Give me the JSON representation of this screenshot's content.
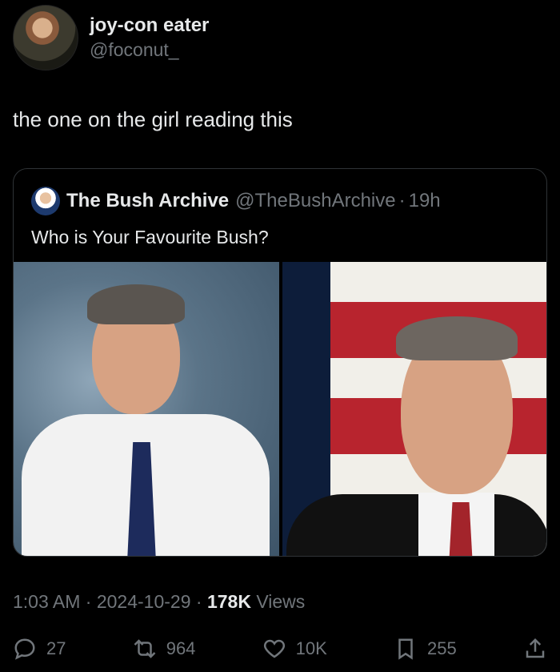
{
  "author": {
    "display_name": "joy-con eater",
    "handle": "@foconut_"
  },
  "tweet": {
    "text": "the one on the girl reading this"
  },
  "quote": {
    "display_name": "The Bush Archive",
    "handle": "@TheBushArchive",
    "separator": "·",
    "time": "19h",
    "text": "Who is Your Favourite Bush?"
  },
  "meta": {
    "time": "1:03 AM",
    "sep1": " · ",
    "date": "2024-10-29",
    "sep2": " · ",
    "views_count": "178K",
    "views_label": " Views"
  },
  "actions": {
    "replies": "27",
    "reposts": "964",
    "likes": "10K",
    "bookmarks": "255"
  },
  "colors": {
    "background": "#000000",
    "text_primary": "#e7e9ea",
    "text_secondary": "#71767b",
    "border": "#2f3336"
  }
}
